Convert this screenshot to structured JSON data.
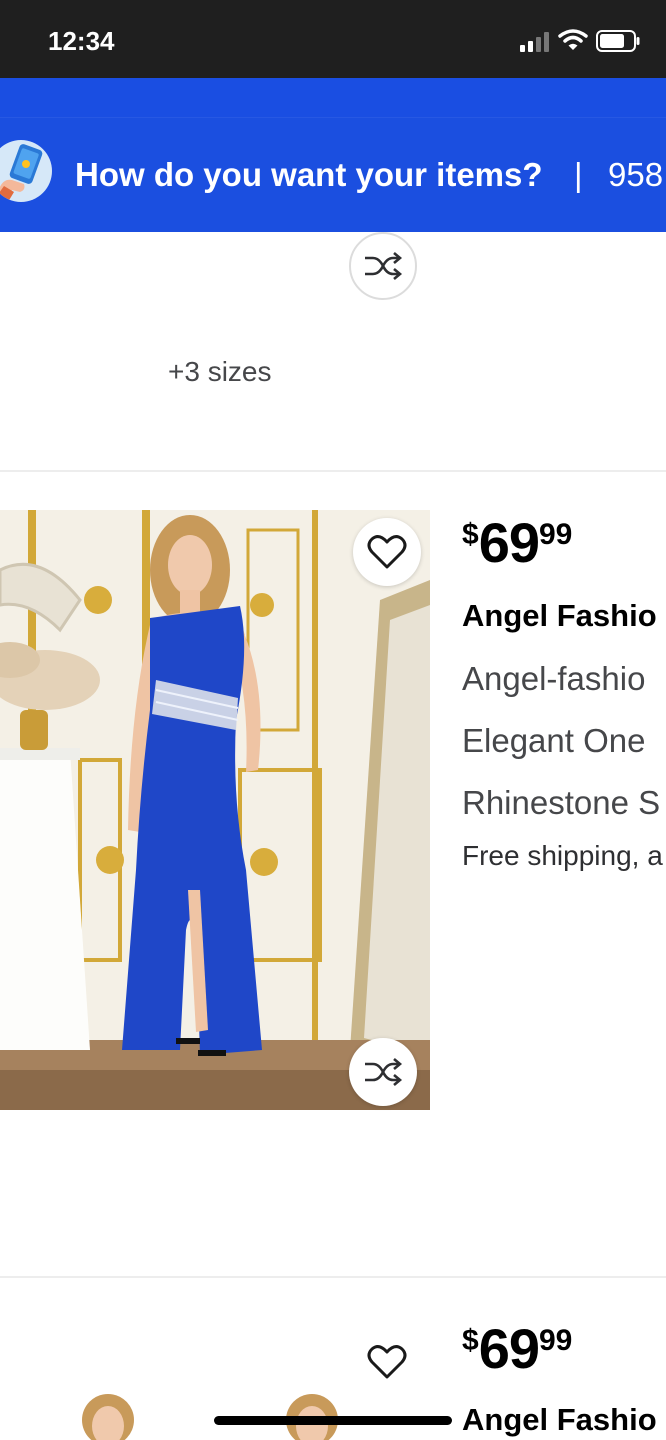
{
  "status_bar": {
    "time": "12:34"
  },
  "banner": {
    "title": "How do you want your items?",
    "separator": "|",
    "zip": "958"
  },
  "prev_item": {
    "sizes_label": "+3 sizes"
  },
  "products": [
    {
      "price_currency": "$",
      "price_whole": "69",
      "price_cents": "99",
      "brand": "Angel Fashio",
      "desc_lines": [
        "Angel-fashio",
        "Elegant One",
        "Rhinestone S"
      ],
      "shipping": "Free shipping, a"
    },
    {
      "price_currency": "$",
      "price_whole": "69",
      "price_cents": "99",
      "brand": "Angel Fashio"
    }
  ],
  "icons": {
    "favorite": "heart-icon",
    "compare": "shuffle-icon"
  },
  "colors": {
    "banner_blue": "#1b4fe0",
    "dress_blue": "#1f47c8",
    "status_bar": "#1f1f1f"
  }
}
